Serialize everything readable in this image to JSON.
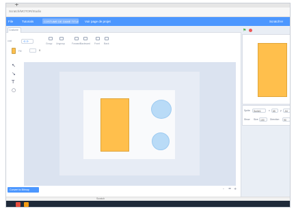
{
  "browser": {
    "new_tab": "+",
    "url": "Scratch/MOTOR/Studio"
  },
  "menubar": {
    "file": "File",
    "tutorials": "Tutorials",
    "project_title": "COSTUME DE GAME TITLE",
    "share": "Voir page de projet",
    "account": "Scratch'er"
  },
  "subbar": {
    "costume_tab": "Costume"
  },
  "paint_toolbar": {
    "costume_label": "cost",
    "group": "Group",
    "ungroup": "Ungroup",
    "forward": "Forward",
    "backward": "Backward",
    "front": "Front",
    "back": "Back",
    "fill_label": "Fill",
    "fill_value": "0",
    "fill_color": "#ffbf4c"
  },
  "sidebar_tools": [
    "select-tool",
    "reshape-tool",
    "text-tool",
    "circle-tool"
  ],
  "canvas": {
    "convert_button": "Convert to Bitmap",
    "zoom_out": "-",
    "zoom_reset": "=",
    "zoom_in": "+"
  },
  "sprite_info": {
    "sprite_label": "Sprite",
    "sprite_name": "Sprite1",
    "x_label": "x",
    "x_value": "65",
    "y_label": "y",
    "y_value": "-54",
    "show_label": "Show",
    "size_label": "Size",
    "size_value": "100",
    "direction_label": "Direction",
    "direction_value": "90"
  },
  "statusbar": {
    "text": "Scratch"
  },
  "colors": {
    "accent": "#4c97ff",
    "shape_fill": "#ffbf4c",
    "circle_fill": "#b9dbf7"
  }
}
